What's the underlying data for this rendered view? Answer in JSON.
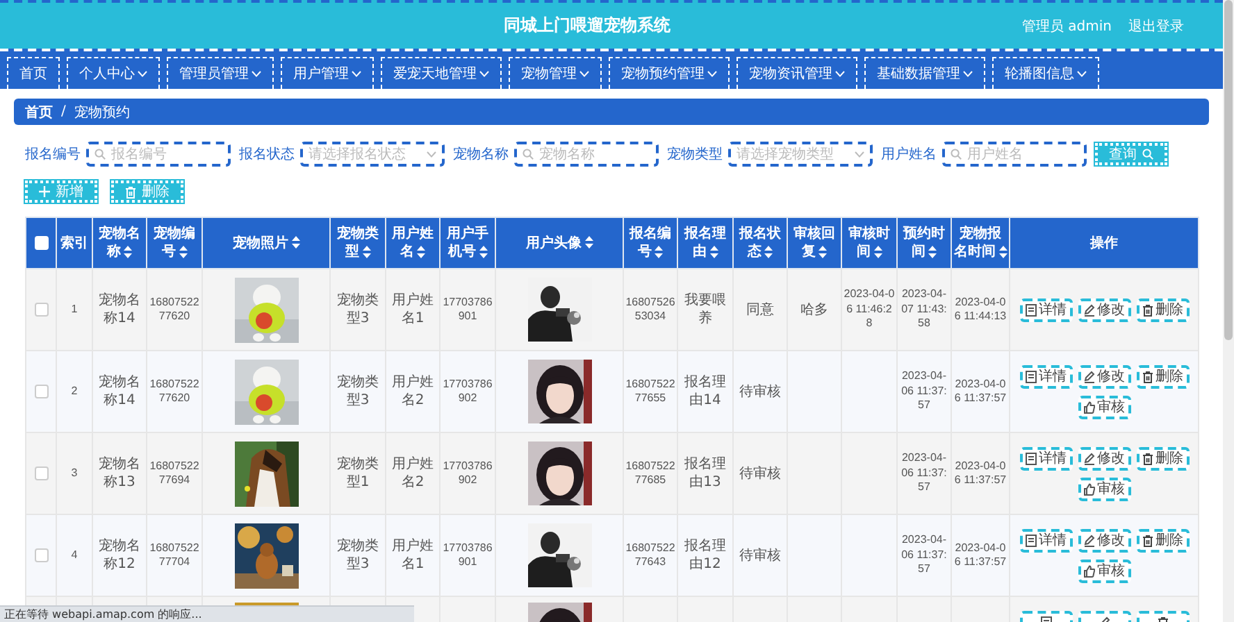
{
  "header": {
    "title": "同城上门喂遛宠物系统",
    "user": "管理员 admin",
    "logout": "退出登录"
  },
  "nav": [
    {
      "label": "首页",
      "dropdown": false
    },
    {
      "label": "个人中心",
      "dropdown": true
    },
    {
      "label": "管理员管理",
      "dropdown": true
    },
    {
      "label": "用户管理",
      "dropdown": true
    },
    {
      "label": "爱宠天地管理",
      "dropdown": true
    },
    {
      "label": "宠物管理",
      "dropdown": true
    },
    {
      "label": "宠物预约管理",
      "dropdown": true
    },
    {
      "label": "宠物资讯管理",
      "dropdown": true
    },
    {
      "label": "基础数据管理",
      "dropdown": true
    },
    {
      "label": "轮播图信息",
      "dropdown": true
    }
  ],
  "breadcrumb": {
    "separator": "/",
    "items": [
      {
        "label": "首页",
        "bold": true
      },
      {
        "label": "宠物预约",
        "bold": false
      }
    ]
  },
  "search": {
    "fields": [
      {
        "label": "报名编号",
        "kind": "input",
        "placeholder": "报名编号"
      },
      {
        "label": "报名状态",
        "kind": "select",
        "placeholder": "请选择报名状态"
      },
      {
        "label": "宠物名称",
        "kind": "input",
        "placeholder": "宠物名称"
      },
      {
        "label": "宠物类型",
        "kind": "select",
        "placeholder": "请选择宠物类型"
      },
      {
        "label": "用户姓名",
        "kind": "input",
        "placeholder": "用户姓名"
      }
    ],
    "button": "查询"
  },
  "actions": [
    {
      "label": "新增",
      "kind": "add"
    },
    {
      "label": "删除",
      "kind": "delete"
    }
  ],
  "table": {
    "select_all": false,
    "columns": [
      {
        "label": "索引",
        "sortable": false
      },
      {
        "label": "宠物名称",
        "sortable": true
      },
      {
        "label": "宠物编号",
        "sortable": true
      },
      {
        "label": "宠物照片",
        "sortable": true
      },
      {
        "label": "宠物类型",
        "sortable": true
      },
      {
        "label": "用户姓名",
        "sortable": true
      },
      {
        "label": "用户手机号",
        "sortable": true
      },
      {
        "label": "用户头像",
        "sortable": true
      },
      {
        "label": "报名编号",
        "sortable": true
      },
      {
        "label": "报名理由",
        "sortable": true
      },
      {
        "label": "报名状态",
        "sortable": true
      },
      {
        "label": "审核回复",
        "sortable": true
      },
      {
        "label": "审核时间",
        "sortable": true
      },
      {
        "label": "预约时间",
        "sortable": true
      },
      {
        "label": "宠物报名时间",
        "sortable": true
      },
      {
        "label": "操作",
        "sortable": false
      }
    ],
    "rows": [
      {
        "selected": false,
        "cells": [
          "1",
          "宠物名称14",
          "1680752277620",
          {
            "kind": "picture"
          },
          "宠物类型3",
          "用户姓名1",
          "17703786901",
          {
            "kind": "picture"
          },
          "1680752653034",
          "我要喂养",
          "同意",
          "哈多",
          "2023-04-06 11:46:28",
          "2023-04-07 11:43:58",
          "2023-04-06 11:44:13"
        ],
        "actions": [
          {
            "label": "详情",
            "kind": "detail"
          },
          {
            "label": "修改",
            "kind": "edit"
          },
          {
            "label": "删除",
            "kind": "delete"
          }
        ]
      },
      {
        "selected": false,
        "cells": [
          "2",
          "宠物名称14",
          "1680752277620",
          {
            "kind": "picture"
          },
          "宠物类型3",
          "用户姓名2",
          "17703786902",
          {
            "kind": "picture"
          },
          "1680752277655",
          "报名理由14",
          "待审核",
          null,
          null,
          "2023-04-06 11:37:57",
          "2023-04-06 11:37:57"
        ],
        "actions": [
          {
            "label": "详情",
            "kind": "detail"
          },
          {
            "label": "修改",
            "kind": "edit"
          },
          {
            "label": "删除",
            "kind": "delete"
          },
          {
            "label": "审核",
            "kind": "review"
          }
        ]
      },
      {
        "selected": false,
        "cells": [
          "3",
          "宠物名称13",
          "1680752277694",
          {
            "kind": "picture"
          },
          "宠物类型1",
          "用户姓名2",
          "17703786902",
          {
            "kind": "picture"
          },
          "1680752277685",
          "报名理由13",
          "待审核",
          null,
          null,
          "2023-04-06 11:37:57",
          "2023-04-06 11:37:57"
        ],
        "actions": [
          {
            "label": "详情",
            "kind": "detail"
          },
          {
            "label": "修改",
            "kind": "edit"
          },
          {
            "label": "删除",
            "kind": "delete"
          },
          {
            "label": "审核",
            "kind": "review"
          }
        ]
      },
      {
        "selected": false,
        "cells": [
          "4",
          "宠物名称12",
          "1680752277704",
          {
            "kind": "picture"
          },
          "宠物类型3",
          "用户姓名1",
          "17703786901",
          {
            "kind": "picture"
          },
          "1680752277643",
          "报名理由12",
          "待审核",
          null,
          null,
          "2023-04-06 11:37:57",
          "2023-04-06 11:37:57"
        ],
        "actions": [
          {
            "label": "详情",
            "kind": "detail"
          },
          {
            "label": "修改",
            "kind": "edit"
          },
          {
            "label": "删除",
            "kind": "delete"
          },
          {
            "label": "审核",
            "kind": "review"
          }
        ]
      },
      {
        "cells": [
          null,
          null,
          null,
          {
            "kind": "picture"
          },
          null,
          null,
          null,
          {
            "kind": "picture"
          },
          null,
          null,
          null,
          null,
          null,
          null,
          null
        ],
        "actions": [
          {
            "kind": "detail"
          },
          {
            "kind": "edit"
          },
          {
            "kind": "delete"
          }
        ]
      }
    ]
  },
  "status_bar": "正在等待 webapi.amap.com 的响应..."
}
